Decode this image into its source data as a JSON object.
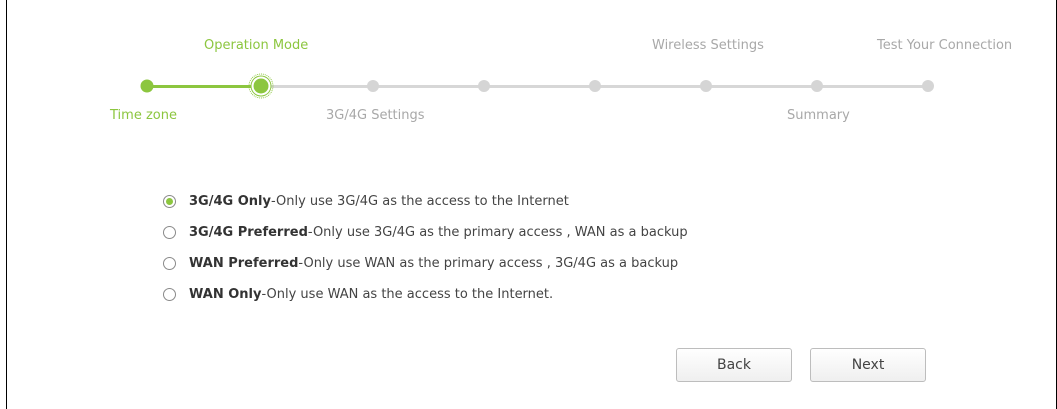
{
  "wizard": {
    "steps": [
      {
        "label": "Time zone",
        "status": "done"
      },
      {
        "label": "Operation Mode",
        "status": "current"
      },
      {
        "label": "3G/4G Settings",
        "status": "pending"
      },
      {
        "label": "",
        "status": "pending"
      },
      {
        "label": "",
        "status": "pending"
      },
      {
        "label": "Wireless Settings",
        "status": "pending"
      },
      {
        "label": "Summary",
        "status": "pending"
      },
      {
        "label": "Test Your Connection",
        "status": "pending"
      }
    ]
  },
  "options": [
    {
      "title": "3G/4G Only",
      "description": "-Only use 3G/4G as the access to the Internet",
      "selected": true
    },
    {
      "title": "3G/4G Preferred",
      "description": "-Only use 3G/4G as the primary access , WAN as a backup",
      "selected": false
    },
    {
      "title": "WAN Preferred",
      "description": "-Only use WAN as the primary access , 3G/4G as a backup",
      "selected": false
    },
    {
      "title": "WAN Only",
      "description": "-Only use WAN as the access to the Internet.",
      "selected": false
    }
  ],
  "buttons": {
    "back_label": "Back",
    "next_label": "Next"
  },
  "colors": {
    "accent": "#8cc63f",
    "inactive": "#d5d5d5"
  }
}
